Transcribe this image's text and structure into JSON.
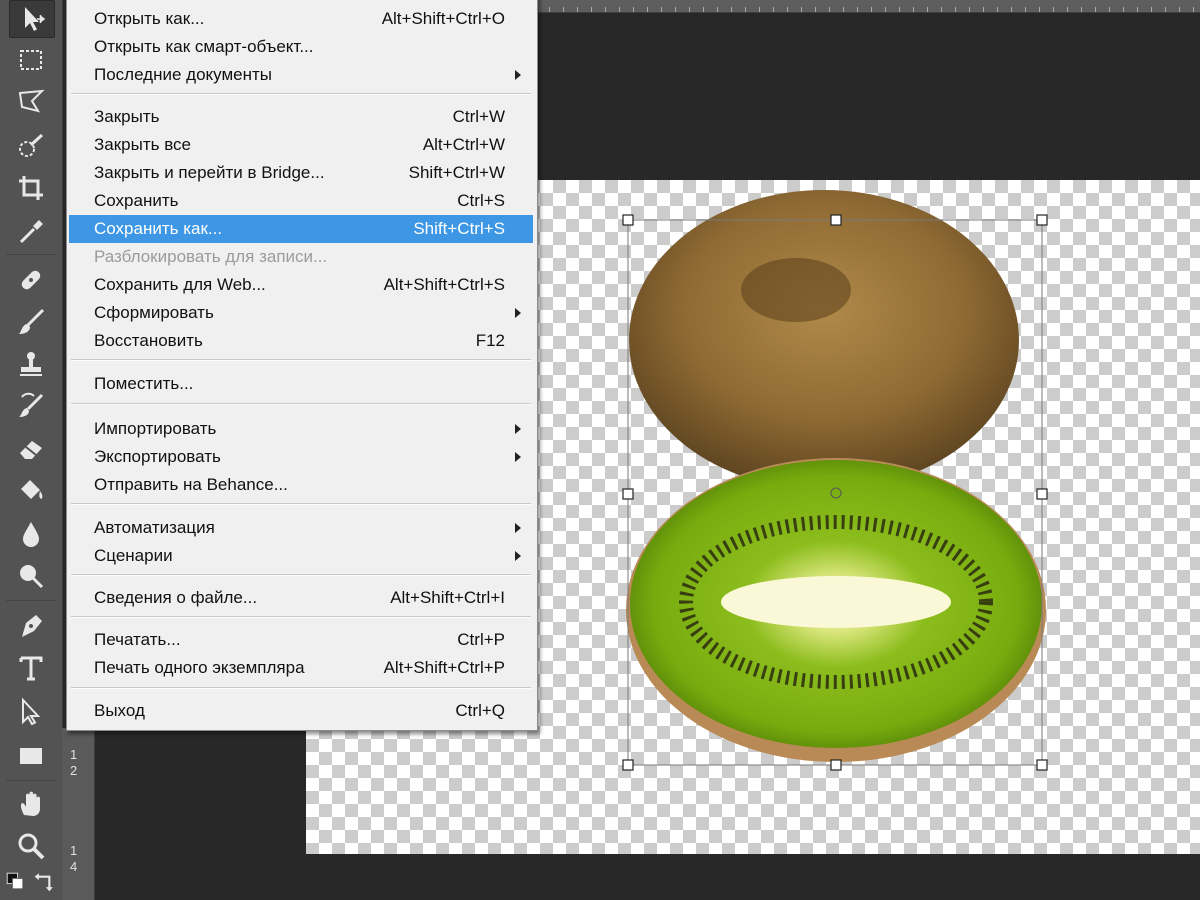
{
  "menu": {
    "items": [
      {
        "label": "Открыть как...",
        "shortcut": "Alt+Shift+Ctrl+O"
      },
      {
        "label": "Открыть как смарт-объект...",
        "shortcut": ""
      },
      {
        "label": "Последние документы",
        "shortcut": ""
      },
      {
        "label": "Закрыть",
        "shortcut": "Ctrl+W"
      },
      {
        "label": "Закрыть все",
        "shortcut": "Alt+Ctrl+W"
      },
      {
        "label": "Закрыть и перейти в Bridge...",
        "shortcut": "Shift+Ctrl+W"
      },
      {
        "label": "Сохранить",
        "shortcut": "Ctrl+S"
      },
      {
        "label": "Сохранить как...",
        "shortcut": "Shift+Ctrl+S"
      },
      {
        "label": "Разблокировать для записи...",
        "shortcut": ""
      },
      {
        "label": "Сохранить для Web...",
        "shortcut": "Alt+Shift+Ctrl+S"
      },
      {
        "label": "Сформировать",
        "shortcut": ""
      },
      {
        "label": "Восстановить",
        "shortcut": "F12"
      },
      {
        "label": "Поместить...",
        "shortcut": ""
      },
      {
        "label": "Импортировать",
        "shortcut": ""
      },
      {
        "label": "Экспортировать",
        "shortcut": ""
      },
      {
        "label": "Отправить на Behance...",
        "shortcut": ""
      },
      {
        "label": "Автоматизация",
        "shortcut": ""
      },
      {
        "label": "Сценарии",
        "shortcut": ""
      },
      {
        "label": "Сведения о файле...",
        "shortcut": "Alt+Shift+Ctrl+I"
      },
      {
        "label": "Печатать...",
        "shortcut": "Ctrl+P"
      },
      {
        "label": "Печать одного экземпляра",
        "shortcut": "Alt+Shift+Ctrl+P"
      },
      {
        "label": "Выход",
        "shortcut": "Ctrl+Q"
      }
    ],
    "highlighted_item": "Сохранить как...",
    "disabled_item": "Разблокировать для записи..."
  },
  "ruler_left": {
    "marks": [
      "1",
      "2",
      "1",
      "4"
    ]
  },
  "toolbar": {
    "tools": [
      "move-tool-icon",
      "marquee-tool-icon",
      "lasso-tool-icon",
      "quick-selection-icon",
      "crop-tool-icon",
      "eyedropper-icon",
      "healing-brush-icon",
      "brush-tool-icon",
      "clone-stamp-icon",
      "history-brush-icon",
      "eraser-icon",
      "paint-bucket-icon",
      "blur-tool-icon",
      "dodge-tool-icon",
      "pen-tool-icon",
      "type-tool-icon",
      "path-selection-icon",
      "rectangle-tool-icon",
      "hand-tool-icon",
      "zoom-tool-icon"
    ]
  },
  "colors": {
    "menu_highlight": "#3d97e4",
    "toolbar_bg": "#535353",
    "workspace_bg": "#282828"
  }
}
